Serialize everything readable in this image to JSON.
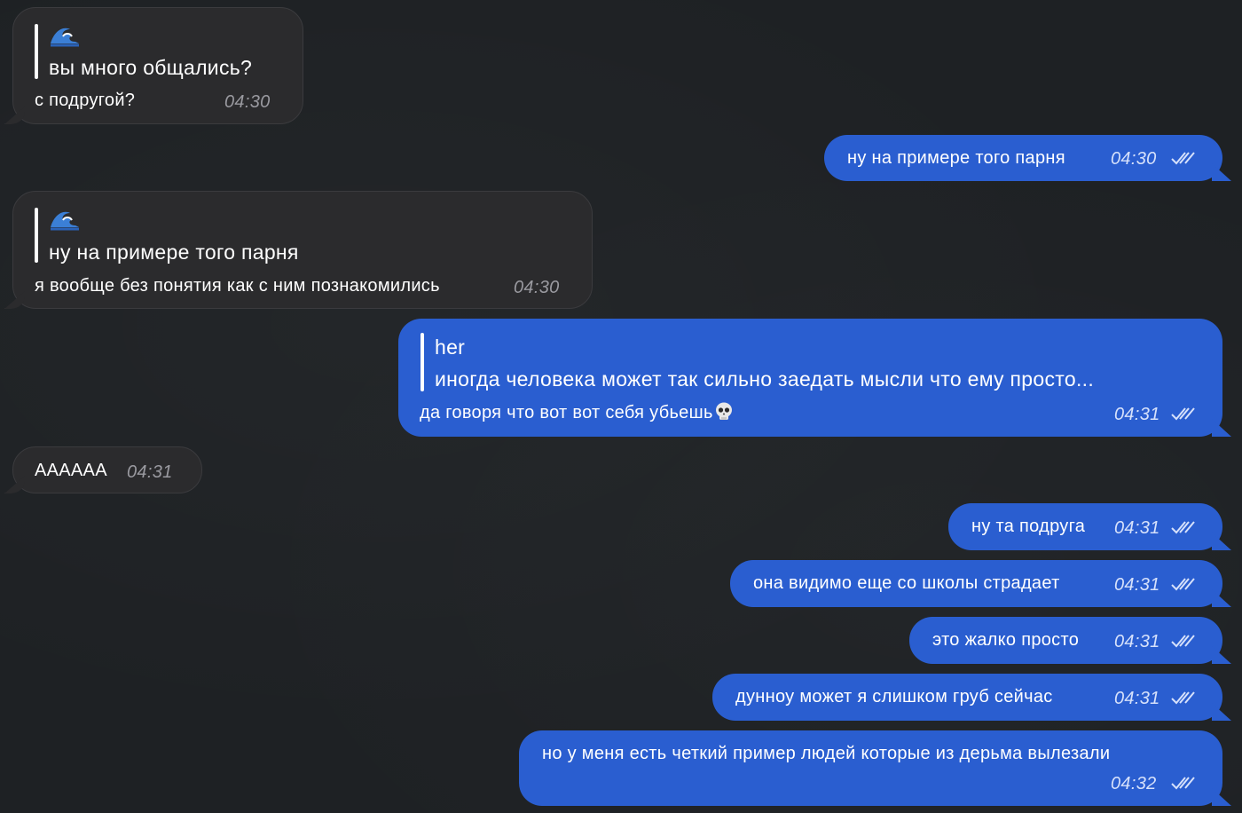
{
  "chat": {
    "messages": [
      {
        "direction": "incoming",
        "reply_icon": "wave-icon",
        "reply_text": "вы много общались?",
        "text": "с подругой?",
        "time": "04:30"
      },
      {
        "direction": "outgoing",
        "text": "ну на примере того парня",
        "time": "04:30",
        "status": "read"
      },
      {
        "direction": "incoming",
        "reply_icon": "wave-icon",
        "reply_text": "ну на примере того парня",
        "text": "я вообще без понятия как с ним познакомились",
        "time": "04:30"
      },
      {
        "direction": "outgoing",
        "reply_author": "her",
        "reply_text": "иногда человека может так сильно заедать мысли что ему просто...",
        "text": "да говоря что вот вот себя убьешь",
        "emoji": "skull-icon",
        "time": "04:31",
        "status": "read"
      },
      {
        "direction": "incoming",
        "text": "АААААА",
        "time": "04:31"
      },
      {
        "direction": "outgoing",
        "text": "ну та подруга",
        "time": "04:31",
        "status": "read"
      },
      {
        "direction": "outgoing",
        "text": "она видимо еще со школы страдает",
        "time": "04:31",
        "status": "read"
      },
      {
        "direction": "outgoing",
        "text": "это жалко просто",
        "time": "04:31",
        "status": "read"
      },
      {
        "direction": "outgoing",
        "text": "дунноу может я слишком груб сейчас",
        "time": "04:31",
        "status": "read"
      },
      {
        "direction": "outgoing",
        "text": "но у меня есть четкий пример людей которые из дерьма вылезали",
        "time": "04:32",
        "status": "read"
      }
    ]
  },
  "colors": {
    "background": "#1e2124",
    "incoming_bubble": "#2b2b2d",
    "outgoing_bubble": "#2a5ed0"
  }
}
